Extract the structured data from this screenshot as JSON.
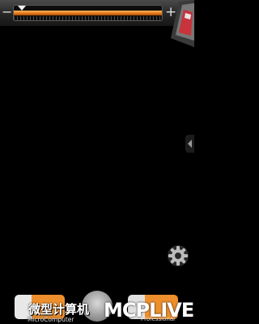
{
  "top_slider": {
    "minus_label": "−",
    "plus_label": "+",
    "level": 0.03,
    "accent_color": "#e27616"
  },
  "icons": {
    "corner": "page-curl-icon",
    "edge_handle": "chevron-left-icon",
    "settings": "gear-icon",
    "dock_left": "phone-icon",
    "dock_center": "home-icon",
    "dock_right": "camera-icon"
  },
  "watermark": {
    "chinese": "微型计算机",
    "english": "MicroComputer",
    "logo": "MCPLIVE",
    "suffix": "Professional"
  }
}
